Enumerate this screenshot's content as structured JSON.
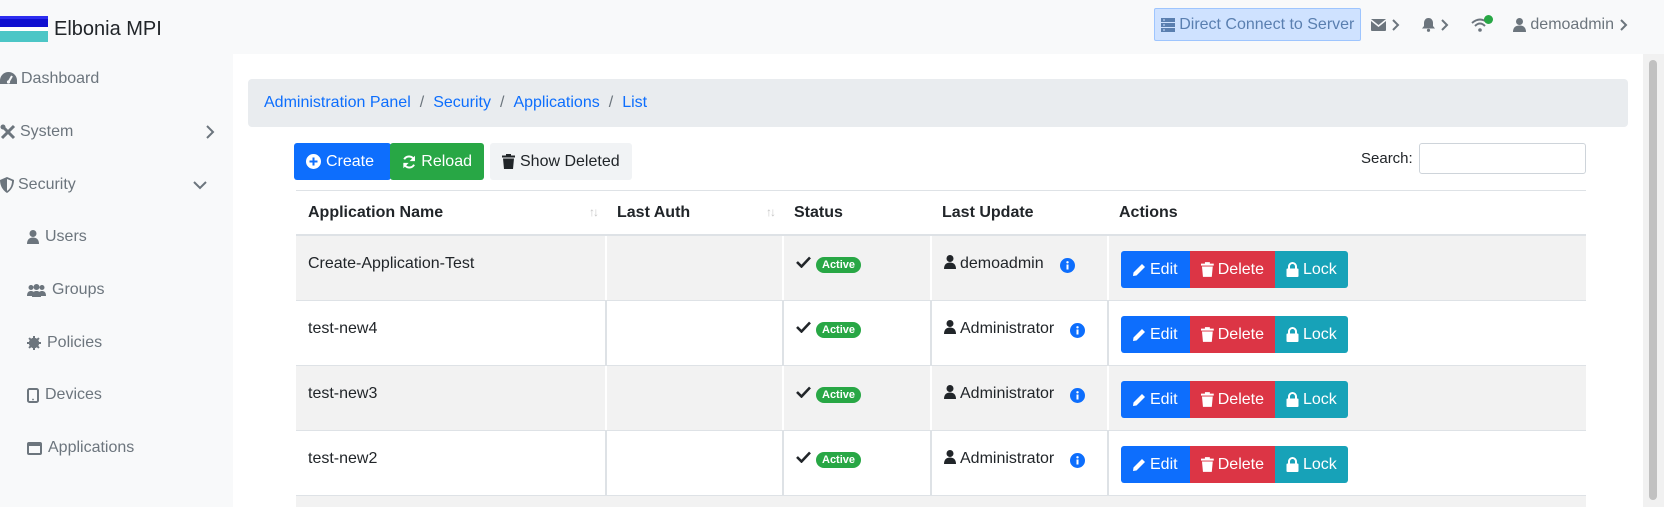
{
  "app": {
    "title": "Elbonia MPI"
  },
  "header": {
    "direct_connect": "Direct Connect to Server",
    "user": "demoadmin"
  },
  "sidebar": {
    "items": [
      {
        "label": "Dashboard",
        "icon": "tachometer-icon"
      },
      {
        "label": "System",
        "icon": "tools-icon"
      },
      {
        "label": "Security",
        "icon": "shield-icon"
      }
    ],
    "sub_items": [
      {
        "label": "Users",
        "icon": "user-icon"
      },
      {
        "label": "Groups",
        "icon": "users-icon"
      },
      {
        "label": "Policies",
        "icon": "gear-badge-icon"
      },
      {
        "label": "Devices",
        "icon": "tablet-icon"
      },
      {
        "label": "Applications",
        "icon": "window-icon"
      }
    ]
  },
  "breadcrumb": [
    "Administration Panel",
    "Security",
    "Applications",
    "List"
  ],
  "toolbar": {
    "create": "Create",
    "reload": "Reload",
    "show_deleted": "Show Deleted",
    "search_label": "Search:"
  },
  "table": {
    "columns": [
      "Application Name",
      "Last Auth",
      "Status",
      "Last Update",
      "Actions"
    ],
    "rows": [
      {
        "name": "Create-Application-Test",
        "last_auth": "",
        "status": "Active",
        "updated_by": "demoadmin"
      },
      {
        "name": "test-new4",
        "last_auth": "",
        "status": "Active",
        "updated_by": "Administrator"
      },
      {
        "name": "test-new3",
        "last_auth": "",
        "status": "Active",
        "updated_by": "Administrator"
      },
      {
        "name": "test-new2",
        "last_auth": "",
        "status": "Active",
        "updated_by": "Administrator"
      }
    ],
    "actions": {
      "edit": "Edit",
      "delete": "Delete",
      "lock": "Lock"
    }
  },
  "colors": {
    "primary": "#0d6efd",
    "success": "#28a745",
    "danger": "#dc3545",
    "info": "#17a2b8"
  }
}
